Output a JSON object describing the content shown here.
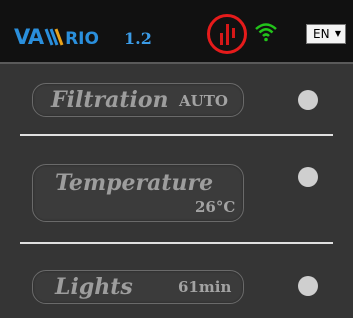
{
  "header": {
    "logo_text_1": "VA",
    "logo_text_2": "RIO",
    "version": "1.2",
    "alert_icon": "warning-bars-icon",
    "wifi_icon": "wifi-icon",
    "language": "EN"
  },
  "colors": {
    "background": "#353535",
    "header": "#111111",
    "accent": "#2a8fdc",
    "alert": "#e61b1b",
    "wifi": "#22c31a"
  },
  "controls": [
    {
      "label": "Filtration",
      "value": "AUTO",
      "indicator": "off"
    },
    {
      "label": "Temperature",
      "value": "26°C",
      "indicator": "off"
    },
    {
      "label": "Lights",
      "value": "61min",
      "indicator": "off"
    }
  ]
}
